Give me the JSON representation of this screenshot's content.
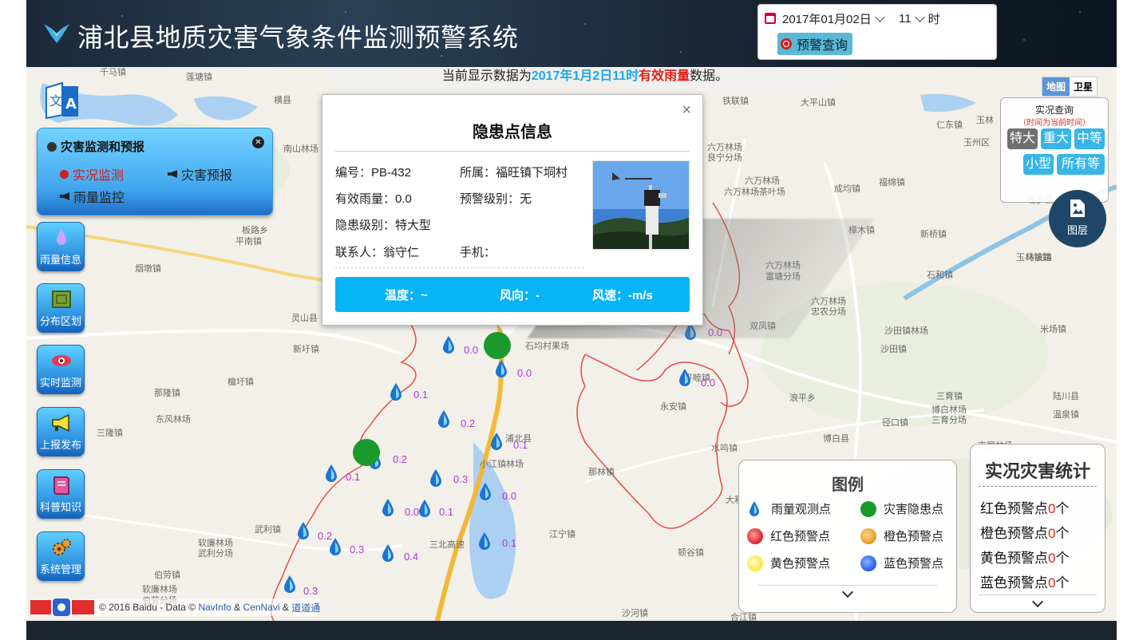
{
  "header": {
    "title": "浦北县地质灾害气象条件监测预警系统",
    "date_value": "2017年01月02日",
    "hour_value": "11",
    "hour_unit": "时",
    "query_button": "预警查询"
  },
  "banner": {
    "prefix": "当前显示数据为",
    "date_text": "2017年1月2日11时",
    "type_text": "有效雨量",
    "suffix": "数据。"
  },
  "map_type": {
    "map": "地图",
    "satellite": "卫星"
  },
  "menu": {
    "title": "灾害监测和预报",
    "items": [
      {
        "label": "实况监测",
        "active": true
      },
      {
        "label": "灾害预报",
        "active": false
      },
      {
        "label": "雨量监控",
        "active": false
      }
    ]
  },
  "side_buttons": [
    {
      "label": "雨量信息",
      "icon": "raindrop-icon"
    },
    {
      "label": "分布区划",
      "icon": "zoning-icon"
    },
    {
      "label": "实时监测",
      "icon": "eye-icon"
    },
    {
      "label": "上报发布",
      "icon": "megaphone-icon"
    },
    {
      "label": "科普知识",
      "icon": "book-icon"
    },
    {
      "label": "系统管理",
      "icon": "gear-icon"
    }
  ],
  "popup": {
    "title": "隐患点信息",
    "close": "×",
    "fields": {
      "id": "编号：PB-432",
      "belongs": "所属：福旺镇下垌村",
      "rain": "有效雨量：0.0",
      "warning": "预警级别：无",
      "hazard_level": "隐患级别：特大型",
      "contact": "联系人：翁守仁",
      "phone": "手机："
    },
    "weather": {
      "temp": "温度：~",
      "wind_dir": "风向：-",
      "wind_speed": "风速：-m/s"
    }
  },
  "live_query": {
    "title": "实况查询",
    "subtitle": "（时间为当前时间）",
    "levels": [
      "特大",
      "重大",
      "中等",
      "小型",
      "所有等级"
    ]
  },
  "layer_button": {
    "label": "图层"
  },
  "legend": {
    "title": "图例",
    "items": [
      {
        "label": "雨量观测点",
        "kind": "drop"
      },
      {
        "label": "灾害隐患点",
        "kind": "dot",
        "color": "#1a9a2a"
      },
      {
        "label": "红色预警点",
        "kind": "dot",
        "color": "#d8232a"
      },
      {
        "label": "橙色预警点",
        "kind": "dot",
        "color": "#e49a1a"
      },
      {
        "label": "黄色预警点",
        "kind": "dot",
        "color": "#f5e83a"
      },
      {
        "label": "蓝色预警点",
        "kind": "dot",
        "color": "#1f5ce8"
      }
    ]
  },
  "stats": {
    "title": "实况灾害统计",
    "items": [
      {
        "prefix": "红色预警点",
        "count": "0",
        "unit": "个"
      },
      {
        "prefix": "橙色预警点",
        "count": "0",
        "unit": "个"
      },
      {
        "prefix": "黄色预警点",
        "count": "0",
        "unit": "个"
      },
      {
        "prefix": "蓝色预警点",
        "count": "0",
        "unit": "个"
      }
    ]
  },
  "attribution": {
    "text": "© 2016 Baidu - Data ©",
    "navinfo": "NavInfo",
    "amp1": "&",
    "cennavi": "CenNavi",
    "amp2": "&",
    "daodaotong": "道道通"
  },
  "rain_values": [
    "0.0",
    "0.0",
    "0.0",
    "0.0",
    "0.2",
    "0.1",
    "0.1",
    "0.2",
    "0.3",
    "0.0",
    "0.1",
    "0.2",
    "0.3",
    "0.4",
    "0.1",
    "0.3",
    "0.0",
    "0.1"
  ],
  "places": [
    "千马镇",
    "莲塘镇",
    "横县",
    "南山林场",
    "板路乡",
    "平南镇",
    "烟墩镇",
    "灵山县",
    "新圩镇",
    "檀圩镇",
    "那隆镇",
    "东风林场",
    "三隆镇",
    "武利镇",
    "软廉林场",
    "武利分场",
    "伯劳镇",
    "软廉林场",
    "伯劳分场",
    "石均村果场",
    "小江镇林场",
    "浦北县",
    "那林镇",
    "江宁镇",
    "水鸣镇",
    "铁联镇",
    "大平山镇",
    "六万林场",
    "良宁分场",
    "六万林场",
    "六万林场茶叶场",
    "成均镇",
    "福绵镇",
    "仁东镇",
    "玉林",
    "玉州区",
    "樟木镇",
    "新桥镇",
    "珊罗镇",
    "马坡镇",
    "石和镇",
    "六万林场",
    "富塘分场",
    "六万林场",
    "忠农分场",
    "双凤镇",
    "沙田镇林场",
    "米场镇",
    "沙田镇",
    "平睦镇",
    "浪平乡",
    "三育镇",
    "博白林场",
    "三育分场",
    "陆川县",
    "温泉镇",
    "永安镇",
    "径口镇",
    "博白县",
    "南屏林场",
    "大利镇",
    "顿谷镇",
    "沙河镇",
    "合江镇",
    "三北高速",
    "玉林铁路"
  ]
}
